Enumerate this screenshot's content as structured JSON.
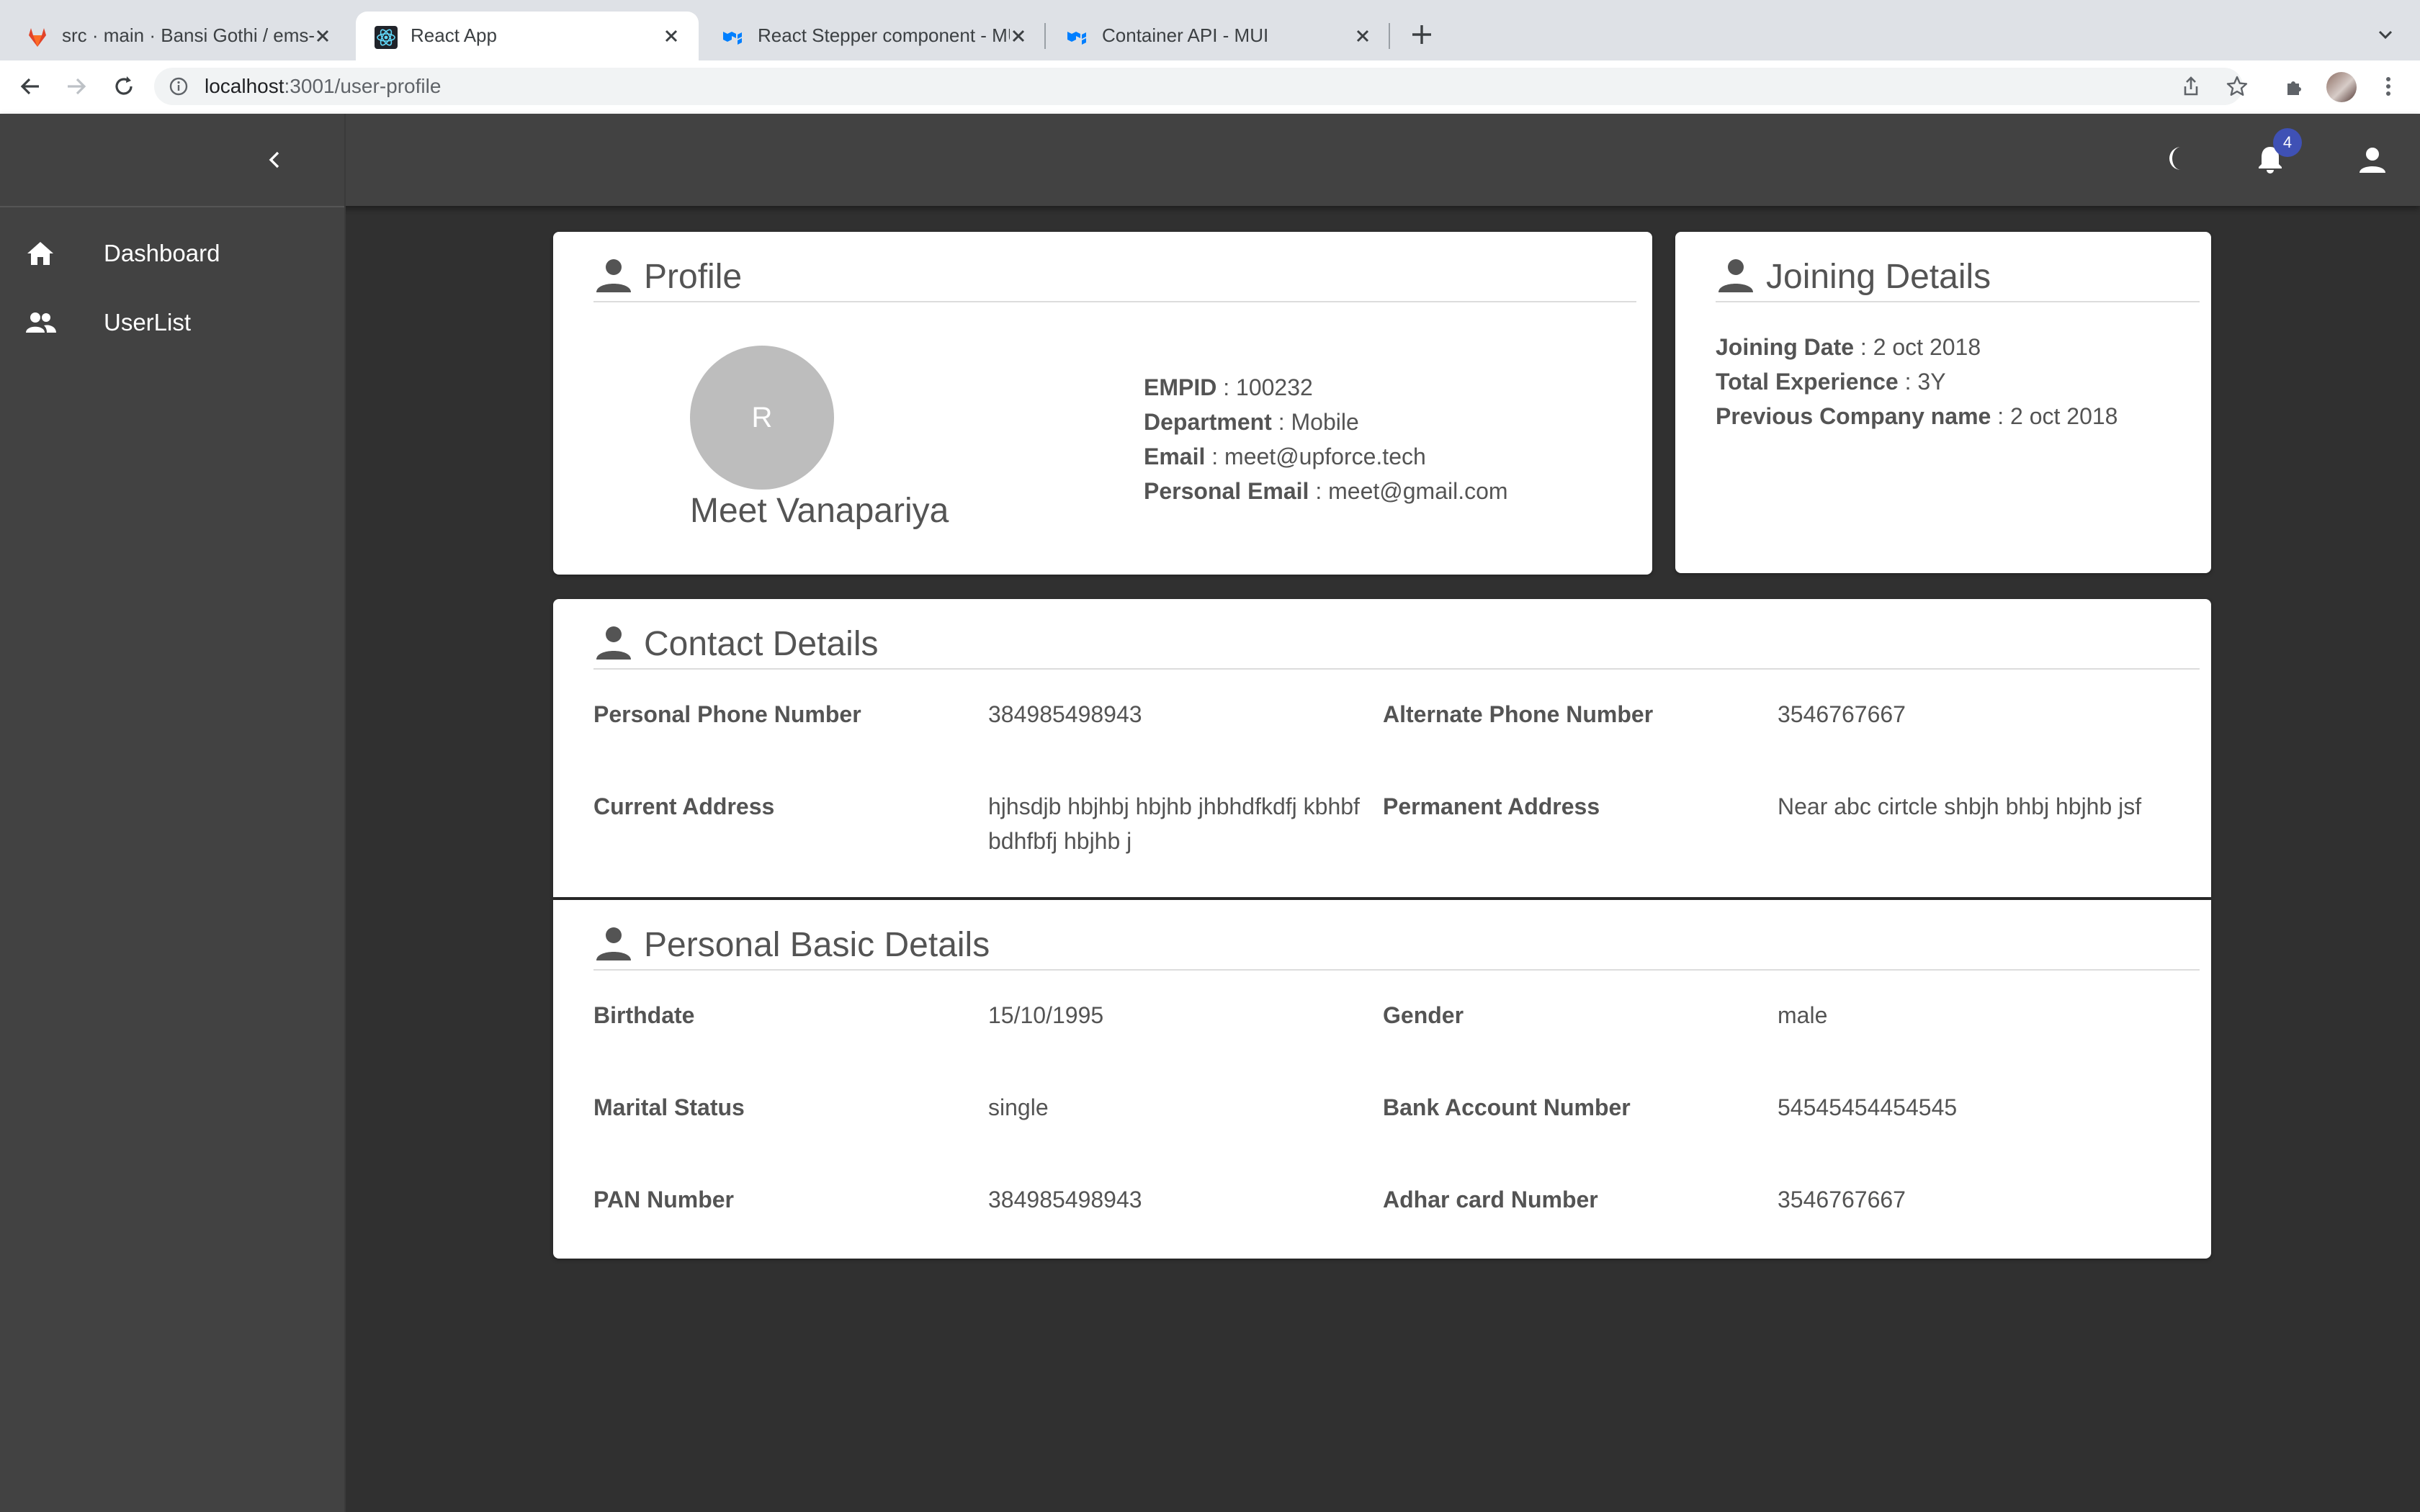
{
  "browser": {
    "tabs": [
      {
        "title": "src · main · Bansi Gothi / ems-f",
        "favicon": "gitlab-icon",
        "active": false
      },
      {
        "title": "React App",
        "favicon": "react-icon",
        "active": true
      },
      {
        "title": "React Stepper component - MUI",
        "favicon": "mui-icon",
        "active": false
      },
      {
        "title": "Container API - MUI",
        "favicon": "mui-icon",
        "active": false
      }
    ],
    "url_host": "localhost",
    "url_path": ":3001/user-profile"
  },
  "appbar": {
    "notification_count": "4"
  },
  "sidebar": {
    "items": [
      {
        "label": "Dashboard",
        "icon": "home-icon"
      },
      {
        "label": "UserList",
        "icon": "people-icon"
      }
    ]
  },
  "profile": {
    "title": "Profile",
    "avatar_letter": "R",
    "name": "Meet Vanapariya",
    "fields": [
      {
        "label": "EMPID",
        "value": "100232"
      },
      {
        "label": "Department",
        "value": "Mobile"
      },
      {
        "label": "Email",
        "value": "meet@upforce.tech"
      },
      {
        "label": "Personal Email",
        "value": "meet@gmail.com"
      }
    ]
  },
  "joining": {
    "title": "Joining Details",
    "fields": [
      {
        "label": "Joining Date",
        "value": "2 oct 2018"
      },
      {
        "label": "Total Experience",
        "value": "3Y"
      },
      {
        "label": "Previous Company name",
        "value": "2 oct 2018"
      }
    ]
  },
  "contact": {
    "title": "Contact Details",
    "rows": [
      {
        "label1": "Personal Phone Number",
        "value1": "384985498943",
        "label2": "Alternate Phone Number",
        "value2": "3546767667"
      },
      {
        "label1": "Current Address",
        "value1": "hjhsdjb hbjhbj hbjhb jhbhdfkdfj kbhbf bdhfbfj hbjhb j",
        "label2": "Permanent Address",
        "value2": "Near abc cirtcle shbjh bhbj hbjhb jsf"
      }
    ]
  },
  "personal": {
    "title": "Personal Basic Details",
    "rows": [
      {
        "label1": "Birthdate",
        "value1": "15/10/1995",
        "label2": "Gender",
        "value2": "male"
      },
      {
        "label1": "Marital Status",
        "value1": "single",
        "label2": "Bank Account Number",
        "value2": "54545454454545"
      },
      {
        "label1": "PAN Number",
        "value1": "384985498943",
        "label2": "Adhar card Number",
        "value2": "3546767667"
      }
    ]
  },
  "colors": {
    "app_bg": "#303030",
    "bar_bg": "#424242",
    "card_bg": "#ffffff",
    "badge": "#3f51b5"
  }
}
